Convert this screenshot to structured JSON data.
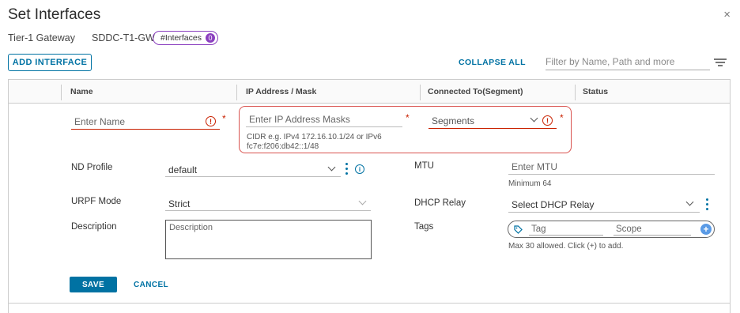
{
  "dialog": {
    "title": "Set Interfaces",
    "gateway_label": "Tier-1 Gateway",
    "gateway_name": "SDDC-T1-GW",
    "interfaces_pill": "#Interfaces",
    "interfaces_count": "0"
  },
  "toolbar": {
    "add_label": "ADD INTERFACE",
    "collapse_label": "COLLAPSE ALL",
    "filter_placeholder": "Filter by Name, Path and more"
  },
  "table": {
    "columns": [
      "Name",
      "IP Address / Mask",
      "Connected To(Segment)",
      "Status"
    ]
  },
  "form": {
    "name_placeholder": "Enter Name",
    "ip_placeholder": "Enter IP Address Masks",
    "ip_hint_line1": "CIDR e.g. IPv4 172.16.10.1/24 or IPv6",
    "ip_hint_line2": "fc7e:f206:db42::1/48",
    "segment_placeholder": "Segments",
    "nd_profile_label": "ND Profile",
    "nd_profile_value": "default",
    "mtu_label": "MTU",
    "mtu_placeholder": "Enter MTU",
    "mtu_hint": "Minimum 64",
    "urpf_label": "URPF Mode",
    "urpf_value": "Strict",
    "dhcp_label": "DHCP Relay",
    "dhcp_placeholder": "Select DHCP Relay",
    "description_label": "Description",
    "description_placeholder": "Description",
    "tags_label": "Tags",
    "tag_placeholder": "Tag",
    "scope_placeholder": "Scope",
    "tags_hint": "Max 30 allowed. Click (+) to add.",
    "save_label": "SAVE",
    "cancel_label": "CANCEL",
    "required_mark": "*",
    "error_glyph": "!",
    "info_glyph": "i",
    "plus_glyph": "+",
    "close_glyph": "×"
  },
  "colors": {
    "accent": "#0072a3",
    "error": "#c92100",
    "pill": "#8b3fbf"
  }
}
